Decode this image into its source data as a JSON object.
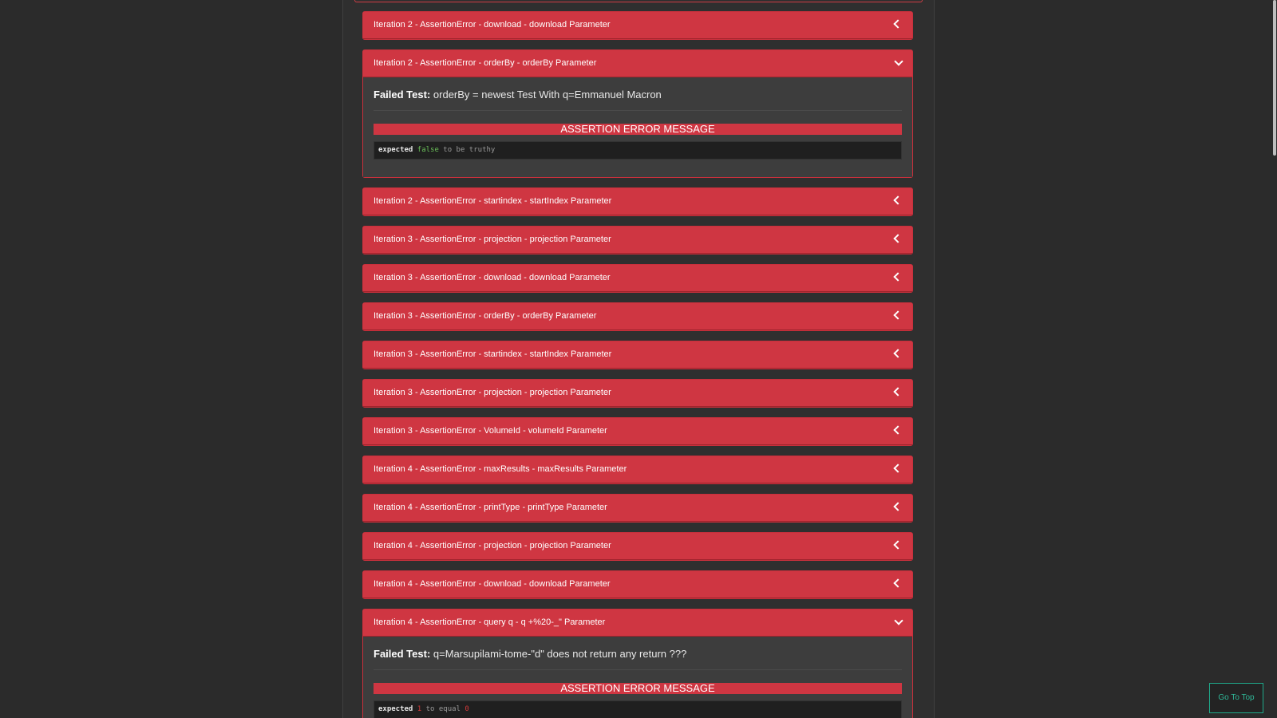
{
  "panels": [
    {
      "title": "Iteration 2 - AssertionError - download - download Parameter",
      "expanded": false
    },
    {
      "title": "Iteration 2 - AssertionError - orderBy - orderBy Parameter",
      "expanded": true,
      "failed_label": "Failed Test:",
      "failed_text": "orderBy = newest Test With q=Emmanuel Macron",
      "error_title": "ASSERTION ERROR MESSAGE",
      "code": {
        "kw": "expected",
        "lit": "false",
        "rest": "to be truthy"
      }
    },
    {
      "title": "Iteration 2 - AssertionError - startindex - startIndex Parameter",
      "expanded": false
    },
    {
      "title": "Iteration 3 - AssertionError - projection - projection Parameter",
      "expanded": false
    },
    {
      "title": "Iteration 3 - AssertionError - download - download Parameter",
      "expanded": false
    },
    {
      "title": "Iteration 3 - AssertionError - orderBy - orderBy Parameter",
      "expanded": false
    },
    {
      "title": "Iteration 3 - AssertionError - startindex - startIndex Parameter",
      "expanded": false
    },
    {
      "title": "Iteration 3 - AssertionError - projection - projection Parameter",
      "expanded": false
    },
    {
      "title": "Iteration 3 - AssertionError - VolumeId - volumeId Parameter",
      "expanded": false
    },
    {
      "title": "Iteration 4 - AssertionError - maxResults - maxResults Parameter",
      "expanded": false
    },
    {
      "title": "Iteration 4 - AssertionError - printType - printType Parameter",
      "expanded": false
    },
    {
      "title": "Iteration 4 - AssertionError - projection - projection Parameter",
      "expanded": false
    },
    {
      "title": "Iteration 4 - AssertionError - download - download Parameter",
      "expanded": false
    },
    {
      "title": "Iteration 4 - AssertionError - query q - q +%20-_\" Parameter",
      "expanded": true,
      "failed_label": "Failed Test:",
      "failed_text": "q=Marsupilami-tome-\"d\" does not return any return ???",
      "error_title": "ASSERTION ERROR MESSAGE",
      "code": {
        "kw": "expected",
        "num1": "1",
        "rest": "to equal",
        "num2": "0"
      }
    }
  ],
  "go_top_label": "Go To Top",
  "colors": {
    "panel_header": "#cf3642",
    "accent_button": "#2fb596",
    "background": "#2b2b2b"
  }
}
